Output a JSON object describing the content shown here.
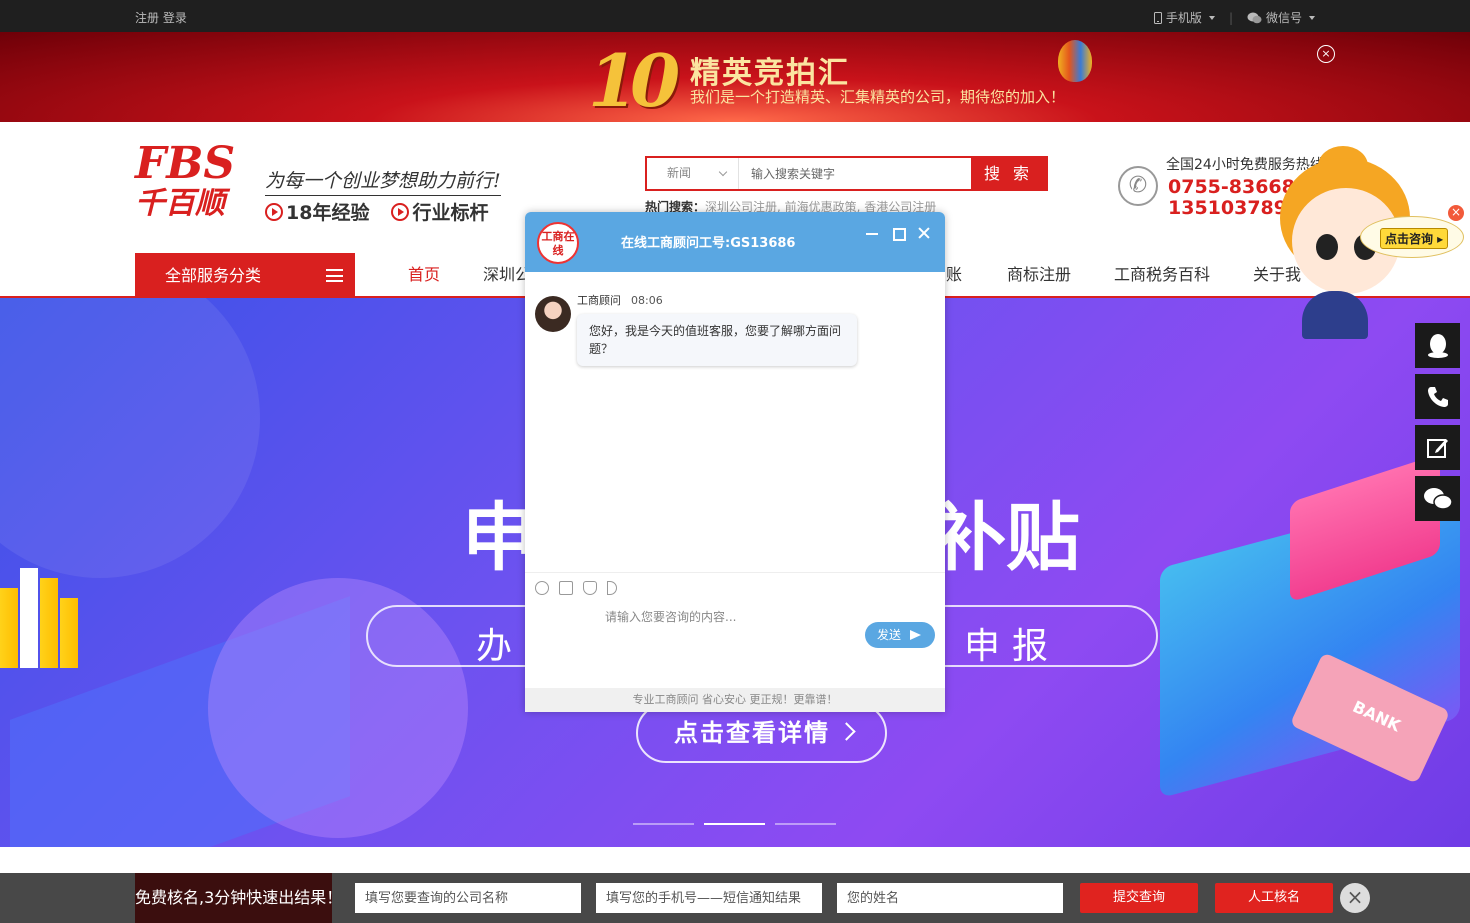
{
  "topbar": {
    "register_login": "注册 登录",
    "mobile": "手机版",
    "wechat": "微信号"
  },
  "ad": {
    "number": "10",
    "title": "精英竞拍汇",
    "subtitle": "我们是一个打造精英、汇集精英的公司，期待您的加入！"
  },
  "logo": {
    "fbs": "FBS",
    "cn": "千百顺"
  },
  "slogan": "为每一个创业梦想助力前行!",
  "tags": [
    "18年经验",
    "行业标杆"
  ],
  "search": {
    "category": "新闻",
    "placeholder": "输入搜索关键字",
    "button": "搜 索",
    "hot_label": "热门搜索：",
    "hot_terms": "深圳公司注册, 前海优惠政策, 香港公司注册"
  },
  "hotline": {
    "label": "全国24小时免费服务热线",
    "phone1": "0755-83668988",
    "phone2": "13510378988"
  },
  "nav": {
    "all_services": "全部服务分类",
    "items": [
      {
        "label": "首页",
        "active": true
      },
      {
        "label": "深圳公"
      },
      {
        "label": "账"
      },
      {
        "label": "商标注册"
      },
      {
        "label": "工商税务百科"
      },
      {
        "label": "关于我"
      }
    ]
  },
  "hero": {
    "line0_left": "",
    "line0_right": "]",
    "line1_left": "申",
    "line1_right": "补贴",
    "pill_left": "办",
    "pill_right": "申报",
    "detail_button": "点击查看详情",
    "slides": 3,
    "active_slide": 2,
    "card_text": "BANK"
  },
  "mascot": {
    "consult": "点击咨询 ▸"
  },
  "chat": {
    "avatar_text": "工商在线",
    "title": "在线工商顾问工号:GS13686",
    "agent_name": "工商顾问",
    "time": "08:06",
    "message": "您好，我是今天的值班客服，您要了解哪方面问题？",
    "input_placeholder": "请输入您要咨询的内容...",
    "send": "发送",
    "footer": "专业工商顾问 省心安心 更正规！更靠谱！"
  },
  "bottombar": {
    "lead": "免费核名,3分钟快速出结果！",
    "company_placeholder": "填写您要查询的公司名称",
    "phone_placeholder": "填写您的手机号——短信通知结果",
    "name_placeholder": "您的姓名",
    "submit": "提交查询",
    "manual": "人工核名"
  },
  "colors": {
    "brand_red": "#d9201f",
    "chat_blue": "#5aa7e2",
    "topbar": "#1f1f1f"
  }
}
